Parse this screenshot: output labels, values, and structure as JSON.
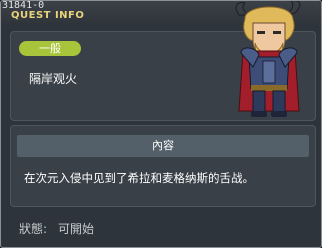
{
  "window": {
    "quest_id": "31841-0",
    "title": "QUEST INFO"
  },
  "quest": {
    "category": "一般",
    "name": "隔岸观火"
  },
  "details": {
    "section_title": "內容",
    "description": "在次元入侵中见到了希拉和麦格纳斯的舌战。"
  },
  "status": {
    "label": "狀態:",
    "value": "可開始"
  },
  "colors": {
    "title": "#e8d27c",
    "tag_bg": "#a8c43a"
  },
  "npc": {
    "icon": "horned-armored-knight-portrait"
  }
}
